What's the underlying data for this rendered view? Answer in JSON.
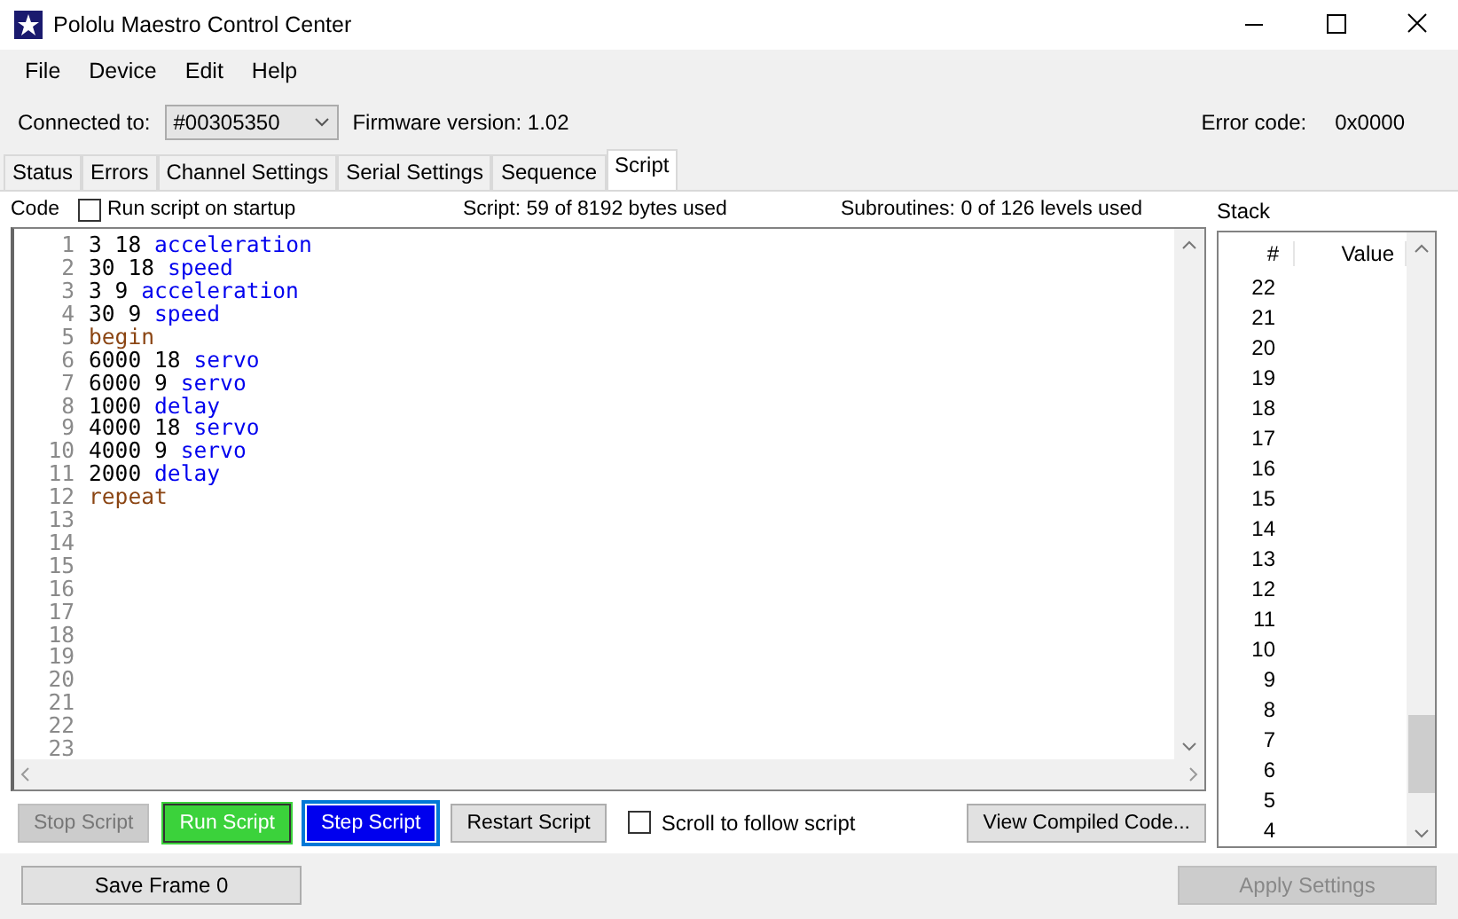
{
  "window": {
    "title": "Pololu Maestro Control Center"
  },
  "menu": [
    "File",
    "Device",
    "Edit",
    "Help"
  ],
  "connection": {
    "label": "Connected to:",
    "device": "#00305350",
    "firmware": "Firmware version: 1.02",
    "error_label": "Error code:",
    "error_value": "0x0000"
  },
  "tabs": [
    {
      "label": "Status",
      "selected": false
    },
    {
      "label": "Errors",
      "selected": false
    },
    {
      "label": "Channel Settings",
      "selected": false
    },
    {
      "label": "Serial Settings",
      "selected": false
    },
    {
      "label": "Sequence",
      "selected": false
    },
    {
      "label": "Script",
      "selected": true
    }
  ],
  "script": {
    "code_label": "Code",
    "run_on_startup": {
      "label": "Run script on startup",
      "checked": false
    },
    "usage": "Script: 59 of 8192 bytes used",
    "subroutines": "Subroutines: 0 of 126 levels used",
    "lines": [
      {
        "number": "1",
        "tokens": [
          {
            "text": "3 18",
            "kind": "number"
          },
          {
            "text": "acceleration",
            "kind": "command"
          }
        ]
      },
      {
        "number": "2",
        "tokens": [
          {
            "text": "30 18",
            "kind": "number"
          },
          {
            "text": "speed",
            "kind": "command"
          }
        ]
      },
      {
        "number": "3",
        "tokens": [
          {
            "text": "3 9",
            "kind": "number"
          },
          {
            "text": "acceleration",
            "kind": "command"
          }
        ]
      },
      {
        "number": "4",
        "tokens": [
          {
            "text": "30 9",
            "kind": "number"
          },
          {
            "text": "speed",
            "kind": "command"
          }
        ]
      },
      {
        "number": "5",
        "tokens": [
          {
            "text": "begin",
            "kind": "control"
          }
        ]
      },
      {
        "number": "6",
        "tokens": [
          {
            "text": "6000 18",
            "kind": "number"
          },
          {
            "text": "servo",
            "kind": "command"
          }
        ]
      },
      {
        "number": "7",
        "tokens": [
          {
            "text": "6000 9",
            "kind": "number"
          },
          {
            "text": "servo",
            "kind": "command"
          }
        ]
      },
      {
        "number": "8",
        "tokens": [
          {
            "text": "1000",
            "kind": "number"
          },
          {
            "text": "delay",
            "kind": "command"
          }
        ]
      },
      {
        "number": "9",
        "tokens": [
          {
            "text": "4000 18",
            "kind": "number"
          },
          {
            "text": "servo",
            "kind": "command"
          }
        ]
      },
      {
        "number": "10",
        "tokens": [
          {
            "text": "4000 9",
            "kind": "number"
          },
          {
            "text": "servo",
            "kind": "command"
          }
        ]
      },
      {
        "number": "11",
        "tokens": [
          {
            "text": "2000",
            "kind": "number"
          },
          {
            "text": "delay",
            "kind": "command"
          }
        ]
      },
      {
        "number": "12",
        "tokens": [
          {
            "text": "repeat",
            "kind": "control"
          }
        ]
      },
      {
        "number": "13"
      },
      {
        "number": "14"
      },
      {
        "number": "15"
      },
      {
        "number": "16"
      },
      {
        "number": "17"
      },
      {
        "number": "18"
      },
      {
        "number": "19"
      },
      {
        "number": "20"
      },
      {
        "number": "21"
      },
      {
        "number": "22"
      },
      {
        "number": "23"
      }
    ],
    "buttons": [
      {
        "label": "Stop Script",
        "kind": "disabled"
      },
      {
        "label": "Run Script",
        "kind": "green"
      },
      {
        "label": "Step Script",
        "kind": "blue"
      },
      {
        "label": "Restart Script",
        "kind": "normal"
      }
    ],
    "scroll_follow": {
      "label": "Scroll to follow script",
      "checked": false
    },
    "view_compiled": "View Compiled Code..."
  },
  "stack": {
    "title": "Stack",
    "columns": [
      "#",
      "Value"
    ],
    "rows": [
      "22",
      "21",
      "20",
      "19",
      "18",
      "17",
      "16",
      "15",
      "14",
      "13",
      "12",
      "11",
      "10",
      "9",
      "8",
      "7",
      "6",
      "5",
      "4"
    ]
  },
  "footer": {
    "save_frame": "Save Frame 0",
    "apply": {
      "label": "Apply Settings",
      "disabled": true
    }
  }
}
